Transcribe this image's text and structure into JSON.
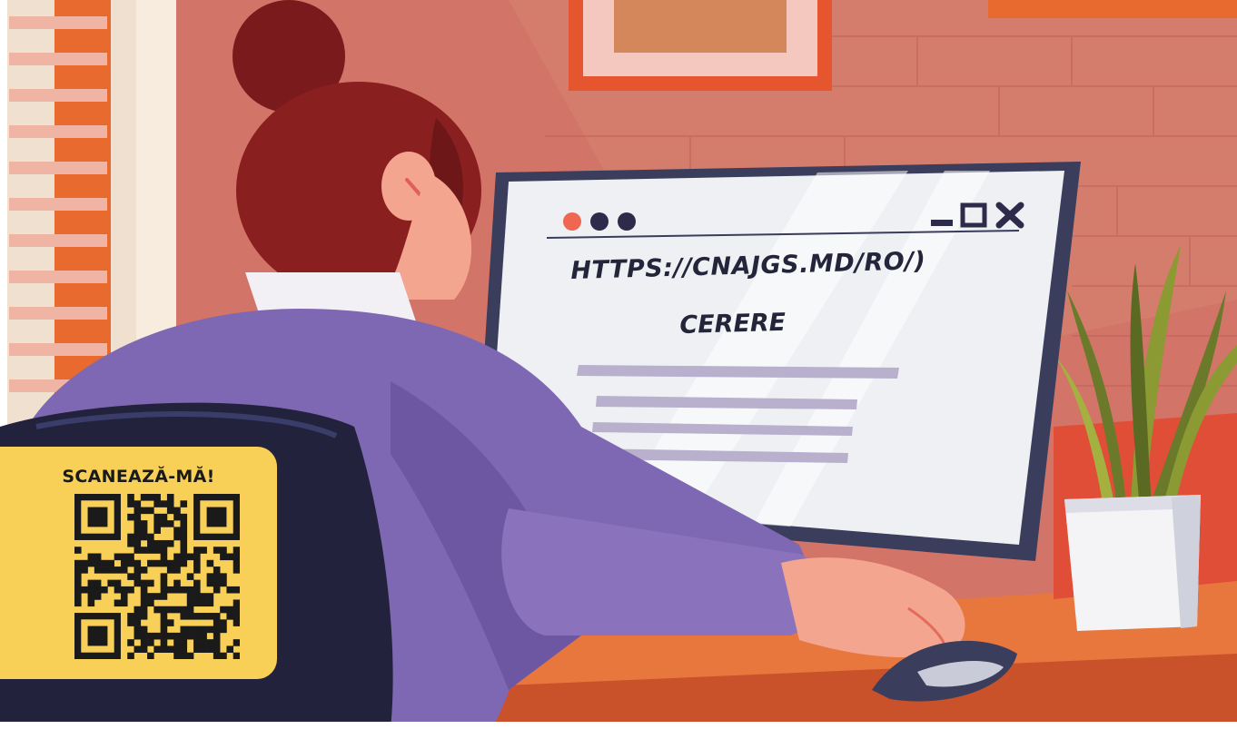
{
  "screen": {
    "url": "HTTPS://CNAJGS.MD/RO/)",
    "title": "CERERE",
    "window_dots": [
      "#ef6651",
      "#2e2b4a",
      "#2e2b4a"
    ],
    "window_controls": [
      "minimize-icon",
      "maximize-icon",
      "close-icon"
    ]
  },
  "qr_card": {
    "label": "SCANEAZĂ-MĂ!",
    "background": "#f8d057"
  },
  "colors": {
    "wall": "#d4766b",
    "sweater": "#7f68b3",
    "hair": "#8a1f20",
    "desk": "#e8773e"
  }
}
